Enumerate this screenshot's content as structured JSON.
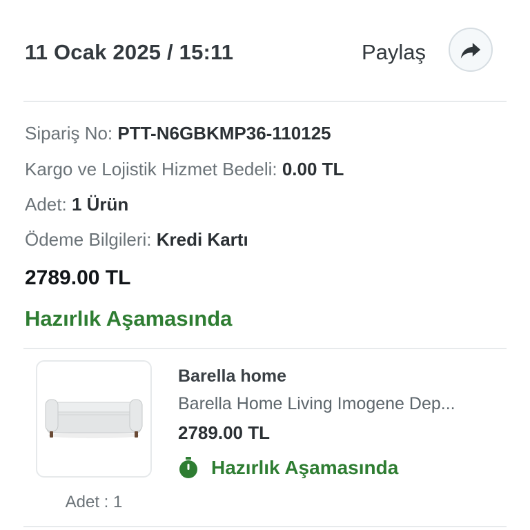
{
  "header": {
    "date_time": "11 Ocak 2025 / 15:11",
    "share_label": "Paylaş",
    "share_icon": "share-arrow-icon"
  },
  "order": {
    "order_no_label": "Sipariş No:",
    "order_no_value": "PTT-N6GBKMP36-110125",
    "shipping_label": "Kargo ve Lojistik Hizmet Bedeli:",
    "shipping_value": "0.00 TL",
    "quantity_label": "Adet:",
    "quantity_value": "1 Ürün",
    "payment_label": "Ödeme Bilgileri:",
    "payment_value": "Kredi Kartı",
    "total": "2789.00 TL",
    "status": "Hazırlık Aşamasında"
  },
  "item": {
    "brand": "Barella home",
    "name": "Barella Home Living Imogene Dep...",
    "price": "2789.00 TL",
    "status": "Hazırlık Aşamasında",
    "status_icon": "stopwatch-icon",
    "qty_text": "Adet : 1",
    "image_icon": "storage-bench-product-image"
  },
  "colors": {
    "status_green": "#2e7d32",
    "text_dark": "#33393e",
    "label_gray": "#6b7378",
    "divider": "#e7eaec"
  }
}
